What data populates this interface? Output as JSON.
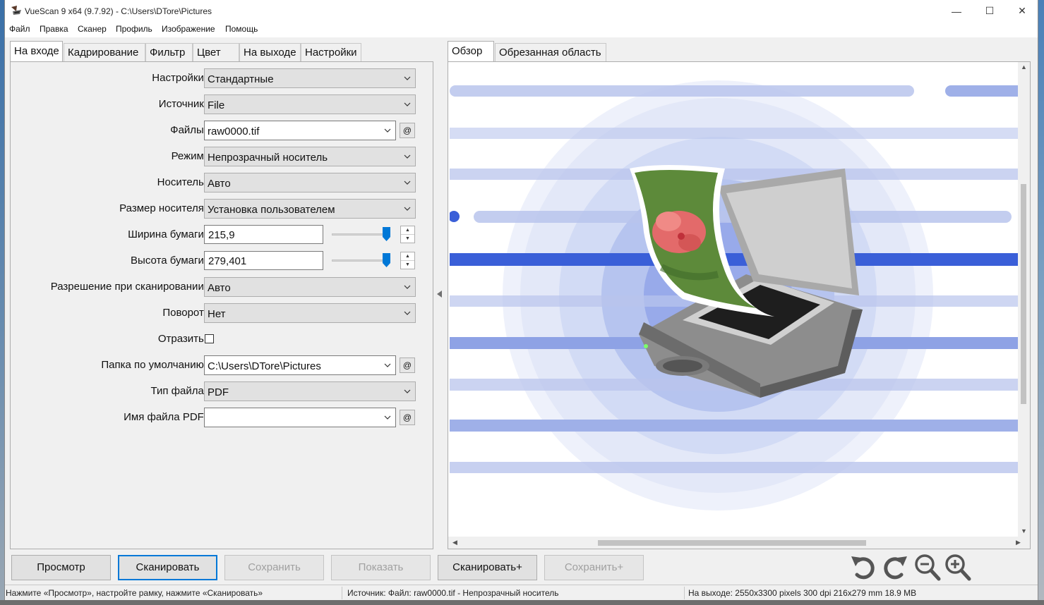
{
  "window": {
    "title": "VueScan 9 x64 (9.7.92) - C:\\Users\\DTore\\Pictures",
    "minimize_glyph": "—",
    "maximize_glyph": "☐",
    "close_glyph": "✕"
  },
  "menu": [
    "Файл",
    "Правка",
    "Сканер",
    "Профиль",
    "Изображение",
    "Помощь"
  ],
  "left_tabs": [
    "На входе",
    "Кадрирование",
    "Фильтр",
    "Цвет",
    "На выходе",
    "Настройки"
  ],
  "right_tabs": [
    "Обзор",
    "Обрезанная область"
  ],
  "form": {
    "settings": {
      "label": "Настройки:",
      "value": "Стандартные"
    },
    "source": {
      "label": "Источник:",
      "value": "File"
    },
    "files": {
      "label": "Файлы:",
      "value": "raw0000.tif"
    },
    "mode": {
      "label": "Режим:",
      "value": "Непрозрачный носитель"
    },
    "media": {
      "label": "Носитель:",
      "value": "Авто"
    },
    "media_size": {
      "label": "Размер носителя:",
      "value": "Установка пользователем"
    },
    "paper_width": {
      "label": "Ширина бумаги:",
      "value": "215,9"
    },
    "paper_height": {
      "label": "Высота бумаги:",
      "value": "279,401"
    },
    "scan_resolution": {
      "label": "Разрешение при сканировании:",
      "value": "Авто"
    },
    "rotation": {
      "label": "Поворот:",
      "value": "Нет"
    },
    "mirror": {
      "label": "Отразить:",
      "checked": false
    },
    "default_folder": {
      "label": "Папка по умолчанию:",
      "value": "C:\\Users\\DTore\\Pictures"
    },
    "file_type": {
      "label": "Тип файла:",
      "value": "PDF"
    },
    "pdf_file_name": {
      "label": "Имя файла PDF:",
      "value": ""
    },
    "at_label": "@"
  },
  "buttons": {
    "preview": "Просмотр",
    "scan": "Сканировать",
    "save": "Сохранить",
    "show": "Показать",
    "scan_plus": "Сканировать+",
    "save_plus": "Сохранить+"
  },
  "status": {
    "hint": "Нажмите «Просмотр», настройте рамку, нажмите «Сканировать»",
    "source": "Источник: Файл: raw0000.tif - Непрозрачный носитель",
    "output": "На выходе: 2550x3300 pixels 300 dpi 216x279 mm 18.9 MB"
  },
  "colors": {
    "accent": "#0078d7",
    "preview_blue": "#3a5fd8",
    "preview_light": "#b9c4ec"
  }
}
